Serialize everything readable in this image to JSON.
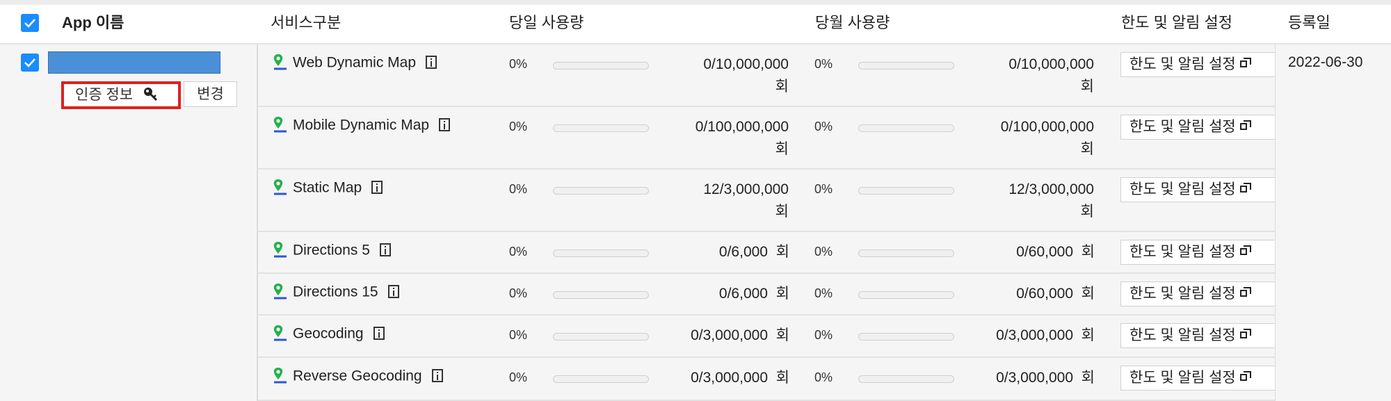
{
  "header": {
    "app_name": "App 이름",
    "service": "서비스구분",
    "daily_usage": "당일 사용량",
    "monthly_usage": "당월 사용량",
    "limit_settings": "한도 및 알림 설정",
    "registered": "등록일"
  },
  "app": {
    "auth_label": "인증 정보",
    "change_label": "변경",
    "registered_date": "2022-06-30"
  },
  "limit_button_label": "한도 및 알림 설정",
  "rows": [
    {
      "name": "Web Dynamic Map",
      "daily_pct": "0%",
      "daily_fill": 0,
      "daily_usage": "0/10,000,000",
      "daily_unit": "회",
      "monthly_pct": "0%",
      "monthly_fill": 0,
      "monthly_usage": "0/10,000,000",
      "monthly_unit": "회"
    },
    {
      "name": "Mobile Dynamic Map",
      "daily_pct": "0%",
      "daily_fill": 0,
      "daily_usage": "0/100,000,000",
      "daily_unit": "회",
      "monthly_pct": "0%",
      "monthly_fill": 0,
      "monthly_usage": "0/100,000,000",
      "monthly_unit": "회"
    },
    {
      "name": "Static Map",
      "daily_pct": "0%",
      "daily_fill": 0,
      "daily_usage": "12/3,000,000",
      "daily_unit": "회",
      "monthly_pct": "0%",
      "monthly_fill": 0,
      "monthly_usage": "12/3,000,000",
      "monthly_unit": "회"
    },
    {
      "name": "Directions 5",
      "daily_pct": "0%",
      "daily_fill": 0,
      "daily_usage": "0/6,000",
      "daily_unit": "회",
      "monthly_pct": "0%",
      "monthly_fill": 0,
      "monthly_usage": "0/60,000",
      "monthly_unit": "회"
    },
    {
      "name": "Directions 15",
      "daily_pct": "0%",
      "daily_fill": 0,
      "daily_usage": "0/6,000",
      "daily_unit": "회",
      "monthly_pct": "0%",
      "monthly_fill": 0,
      "monthly_usage": "0/60,000",
      "monthly_unit": "회"
    },
    {
      "name": "Geocoding",
      "daily_pct": "0%",
      "daily_fill": 0,
      "daily_usage": "0/3,000,000",
      "daily_unit": "회",
      "monthly_pct": "0%",
      "monthly_fill": 0,
      "monthly_usage": "0/3,000,000",
      "monthly_unit": "회"
    },
    {
      "name": "Reverse Geocoding",
      "daily_pct": "0%",
      "daily_fill": 0,
      "daily_usage": "0/3,000,000",
      "daily_unit": "회",
      "monthly_pct": "0%",
      "monthly_fill": 0,
      "monthly_usage": "0/3,000,000",
      "monthly_unit": "회"
    }
  ],
  "colors": {
    "accent": "#1a8cff",
    "highlight_border": "#e02020",
    "app_name_bar": "#4a90d9"
  },
  "icons": {
    "service": "map-pin-icon",
    "info": "info-icon",
    "open": "new-window-icon",
    "key": "key-icon",
    "checkbox": "checkbox-checked-icon"
  }
}
